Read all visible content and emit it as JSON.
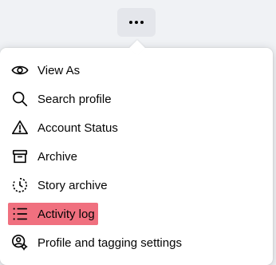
{
  "toolbar": {
    "more_button_icon": "more-horizontal-icon"
  },
  "menu": {
    "items": [
      {
        "label": "View As",
        "icon": "eye-icon"
      },
      {
        "label": "Search profile",
        "icon": "search-icon"
      },
      {
        "label": "Account Status",
        "icon": "warning-icon"
      },
      {
        "label": "Archive",
        "icon": "archive-box-icon"
      },
      {
        "label": "Story archive",
        "icon": "story-archive-icon"
      },
      {
        "label": "Activity log",
        "icon": "list-icon",
        "highlighted": true
      },
      {
        "label": "Profile and tagging settings",
        "icon": "profile-settings-icon"
      }
    ]
  },
  "colors": {
    "highlight": "#f0707f",
    "button_bg": "#e4e6eb",
    "text": "#050505"
  }
}
